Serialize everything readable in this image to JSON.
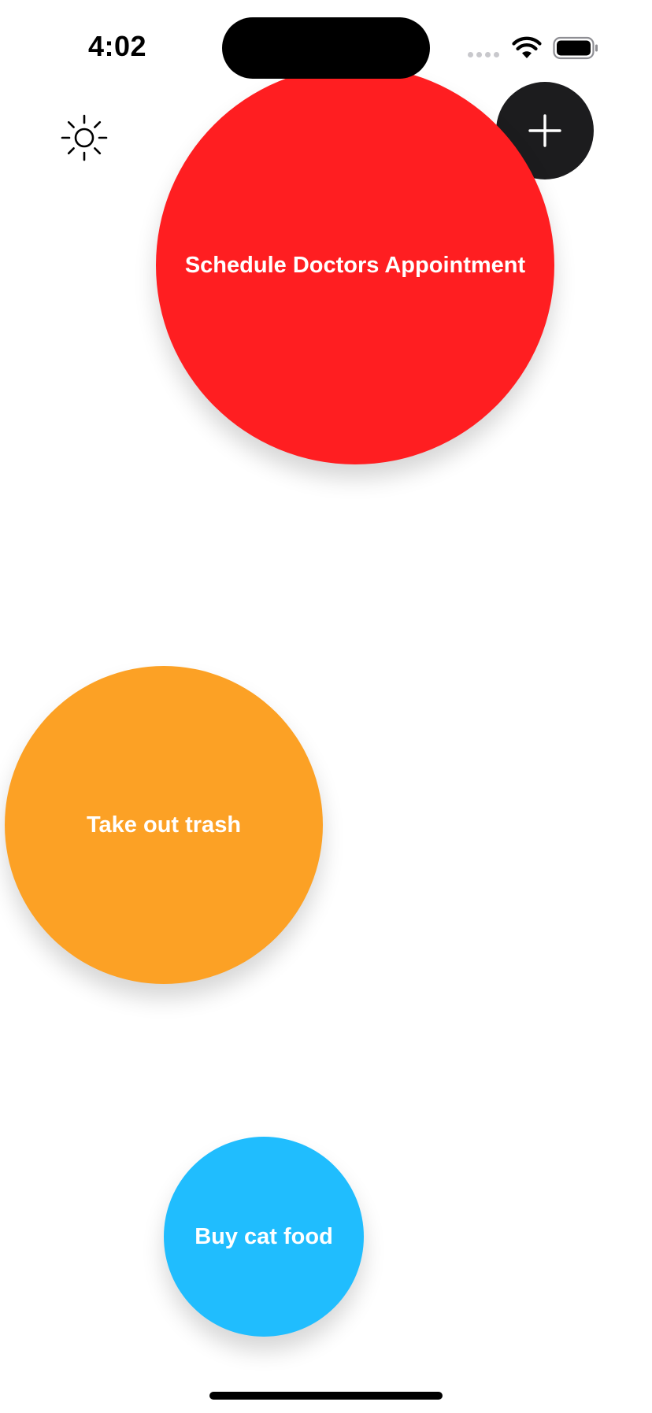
{
  "status_bar": {
    "time": "4:02",
    "icons": [
      "signal-dots-icon",
      "wifi-icon",
      "battery-icon"
    ]
  },
  "toolbar": {
    "brightness_icon": "sun-icon",
    "add_icon": "plus-icon"
  },
  "tasks": [
    {
      "title": "Schedule Doctors Appointment",
      "color": "#ff1e21"
    },
    {
      "title": "Take out trash",
      "color": "#fca125"
    },
    {
      "title": "Buy cat food",
      "color": "#20bdfe"
    }
  ],
  "colors": {
    "add_button": "#1c1c1e",
    "background": "#ffffff"
  }
}
